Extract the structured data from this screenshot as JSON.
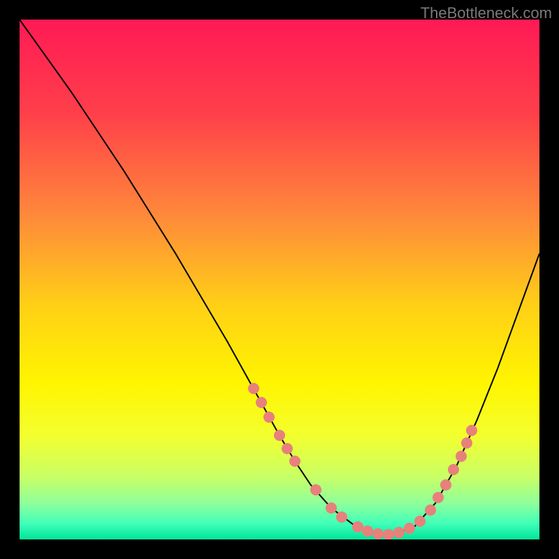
{
  "watermark": "TheBottleneck.com",
  "colors": {
    "background": "#000000",
    "curve_stroke": "#000000",
    "dot_fill": "#e8807c",
    "gradient_stops": [
      {
        "offset": 0.0,
        "color": "#ff1a55"
      },
      {
        "offset": 0.18,
        "color": "#ff3f4a"
      },
      {
        "offset": 0.38,
        "color": "#ff8a3a"
      },
      {
        "offset": 0.55,
        "color": "#ffd016"
      },
      {
        "offset": 0.7,
        "color": "#fff500"
      },
      {
        "offset": 0.8,
        "color": "#f3ff2e"
      },
      {
        "offset": 0.88,
        "color": "#c8ff66"
      },
      {
        "offset": 0.93,
        "color": "#8fff9a"
      },
      {
        "offset": 0.97,
        "color": "#3fffb8"
      },
      {
        "offset": 1.0,
        "color": "#00e49a"
      }
    ]
  },
  "chart_data": {
    "type": "line",
    "title": "",
    "xlabel": "",
    "ylabel": "",
    "xlim": [
      0,
      100
    ],
    "ylim": [
      0,
      100
    ],
    "series": [
      {
        "name": "curve",
        "x": [
          0,
          5,
          10,
          15,
          20,
          25,
          30,
          35,
          40,
          45,
          50,
          53,
          56,
          60,
          64,
          68,
          72,
          76,
          80,
          84,
          88,
          92,
          96,
          100
        ],
        "y": [
          100,
          93,
          86,
          78.5,
          71,
          63,
          55,
          46.5,
          38,
          29,
          20,
          15,
          10.5,
          6,
          3,
          1.3,
          1,
          2.5,
          7,
          14,
          23,
          33,
          44,
          55
        ]
      }
    ],
    "dots": [
      {
        "x": 45.0,
        "y": 29.0
      },
      {
        "x": 46.5,
        "y": 26.3
      },
      {
        "x": 48.0,
        "y": 23.5
      },
      {
        "x": 50.0,
        "y": 20.0
      },
      {
        "x": 51.5,
        "y": 17.5
      },
      {
        "x": 53.0,
        "y": 15.0
      },
      {
        "x": 57.0,
        "y": 9.5
      },
      {
        "x": 60.0,
        "y": 6.0
      },
      {
        "x": 62.0,
        "y": 4.3
      },
      {
        "x": 65.0,
        "y": 2.4
      },
      {
        "x": 67.0,
        "y": 1.6
      },
      {
        "x": 69.0,
        "y": 1.1
      },
      {
        "x": 71.0,
        "y": 1.0
      },
      {
        "x": 73.0,
        "y": 1.3
      },
      {
        "x": 75.0,
        "y": 2.2
      },
      {
        "x": 77.0,
        "y": 3.5
      },
      {
        "x": 79.0,
        "y": 5.6
      },
      {
        "x": 80.5,
        "y": 8.0
      },
      {
        "x": 82.0,
        "y": 10.5
      },
      {
        "x": 83.5,
        "y": 13.5
      },
      {
        "x": 85.0,
        "y": 16.0
      },
      {
        "x": 86.0,
        "y": 18.5
      },
      {
        "x": 87.0,
        "y": 21.0
      }
    ]
  }
}
